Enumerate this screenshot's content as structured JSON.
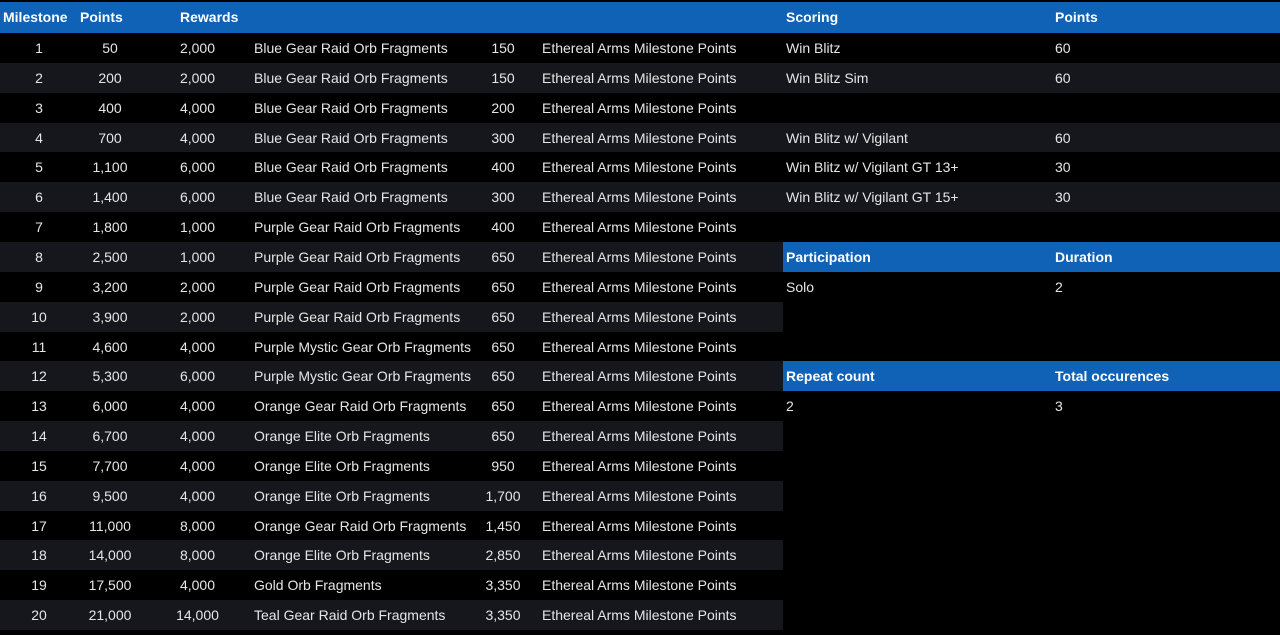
{
  "headers": {
    "milestone": "Milestone",
    "points": "Points",
    "rewards": "Rewards",
    "scoring": "Scoring",
    "scoring_points": "Points"
  },
  "milestones": [
    {
      "n": "1",
      "points": "50",
      "reward": "2,000",
      "item": "Blue Gear Raid Orb Fragments",
      "qty": "150",
      "type": "Ethereal Arms Milestone Points"
    },
    {
      "n": "2",
      "points": "200",
      "reward": "2,000",
      "item": "Blue Gear Raid Orb Fragments",
      "qty": "150",
      "type": "Ethereal Arms Milestone Points"
    },
    {
      "n": "3",
      "points": "400",
      "reward": "4,000",
      "item": "Blue Gear Raid Orb Fragments",
      "qty": "200",
      "type": "Ethereal Arms Milestone Points"
    },
    {
      "n": "4",
      "points": "700",
      "reward": "4,000",
      "item": "Blue Gear Raid Orb Fragments",
      "qty": "300",
      "type": "Ethereal Arms Milestone Points"
    },
    {
      "n": "5",
      "points": "1,100",
      "reward": "6,000",
      "item": "Blue Gear Raid Orb Fragments",
      "qty": "400",
      "type": "Ethereal Arms Milestone Points"
    },
    {
      "n": "6",
      "points": "1,400",
      "reward": "6,000",
      "item": "Blue Gear Raid Orb Fragments",
      "qty": "300",
      "type": "Ethereal Arms Milestone Points"
    },
    {
      "n": "7",
      "points": "1,800",
      "reward": "1,000",
      "item": "Purple Gear Raid Orb Fragments",
      "qty": "400",
      "type": "Ethereal Arms Milestone Points"
    },
    {
      "n": "8",
      "points": "2,500",
      "reward": "1,000",
      "item": "Purple Gear Raid Orb Fragments",
      "qty": "650",
      "type": "Ethereal Arms Milestone Points"
    },
    {
      "n": "9",
      "points": "3,200",
      "reward": "2,000",
      "item": "Purple Gear Raid Orb Fragments",
      "qty": "650",
      "type": "Ethereal Arms Milestone Points"
    },
    {
      "n": "10",
      "points": "3,900",
      "reward": "2,000",
      "item": "Purple Gear Raid Orb Fragments",
      "qty": "650",
      "type": "Ethereal Arms Milestone Points"
    },
    {
      "n": "11",
      "points": "4,600",
      "reward": "4,000",
      "item": "Purple Mystic Gear Orb Fragments",
      "qty": "650",
      "type": "Ethereal Arms Milestone Points"
    },
    {
      "n": "12",
      "points": "5,300",
      "reward": "6,000",
      "item": "Purple Mystic Gear Orb Fragments",
      "qty": "650",
      "type": "Ethereal Arms Milestone Points"
    },
    {
      "n": "13",
      "points": "6,000",
      "reward": "4,000",
      "item": "Orange Gear Raid Orb Fragments",
      "qty": "650",
      "type": "Ethereal Arms Milestone Points"
    },
    {
      "n": "14",
      "points": "6,700",
      "reward": "4,000",
      "item": "Orange Elite Orb Fragments",
      "qty": "650",
      "type": "Ethereal Arms Milestone Points"
    },
    {
      "n": "15",
      "points": "7,700",
      "reward": "4,000",
      "item": "Orange Elite Orb Fragments",
      "qty": "950",
      "type": "Ethereal Arms Milestone Points"
    },
    {
      "n": "16",
      "points": "9,500",
      "reward": "4,000",
      "item": "Orange Elite Orb Fragments",
      "qty": "1,700",
      "type": "Ethereal Arms Milestone Points"
    },
    {
      "n": "17",
      "points": "11,000",
      "reward": "8,000",
      "item": "Orange Gear Raid Orb Fragments",
      "qty": "1,450",
      "type": "Ethereal Arms Milestone Points"
    },
    {
      "n": "18",
      "points": "14,000",
      "reward": "8,000",
      "item": "Orange Elite Orb Fragments",
      "qty": "2,850",
      "type": "Ethereal Arms Milestone Points"
    },
    {
      "n": "19",
      "points": "17,500",
      "reward": "4,000",
      "item": "Gold Orb Fragments",
      "qty": "3,350",
      "type": "Ethereal Arms Milestone Points"
    },
    {
      "n": "20",
      "points": "21,000",
      "reward": "14,000",
      "item": "Teal Gear Raid Orb Fragments",
      "qty": "3,350",
      "type": "Ethereal Arms Milestone Points"
    }
  ],
  "side": [
    {
      "style": "odd",
      "a": "Win Blitz",
      "b": "60"
    },
    {
      "style": "even",
      "a": "Win Blitz Sim",
      "b": "60"
    },
    {
      "style": "odd",
      "a": "",
      "b": ""
    },
    {
      "style": "even",
      "a": "Win Blitz w/ Vigilant",
      "b": "60"
    },
    {
      "style": "odd",
      "a": "Win Blitz w/ Vigilant GT 13+",
      "b": "30"
    },
    {
      "style": "even",
      "a": "Win Blitz w/ Vigilant GT 15+",
      "b": "30"
    },
    {
      "style": "odd",
      "a": "",
      "b": ""
    },
    {
      "style": "blue",
      "a": "Participation",
      "b": "Duration"
    },
    {
      "style": "odd",
      "a": "Solo",
      "b": "2"
    },
    {
      "style": "odd",
      "a": "",
      "b": ""
    },
    {
      "style": "odd",
      "a": "",
      "b": ""
    },
    {
      "style": "blue",
      "a": "Repeat count",
      "b": "Total occurences"
    },
    {
      "style": "odd",
      "a": "2",
      "b": "3"
    }
  ]
}
